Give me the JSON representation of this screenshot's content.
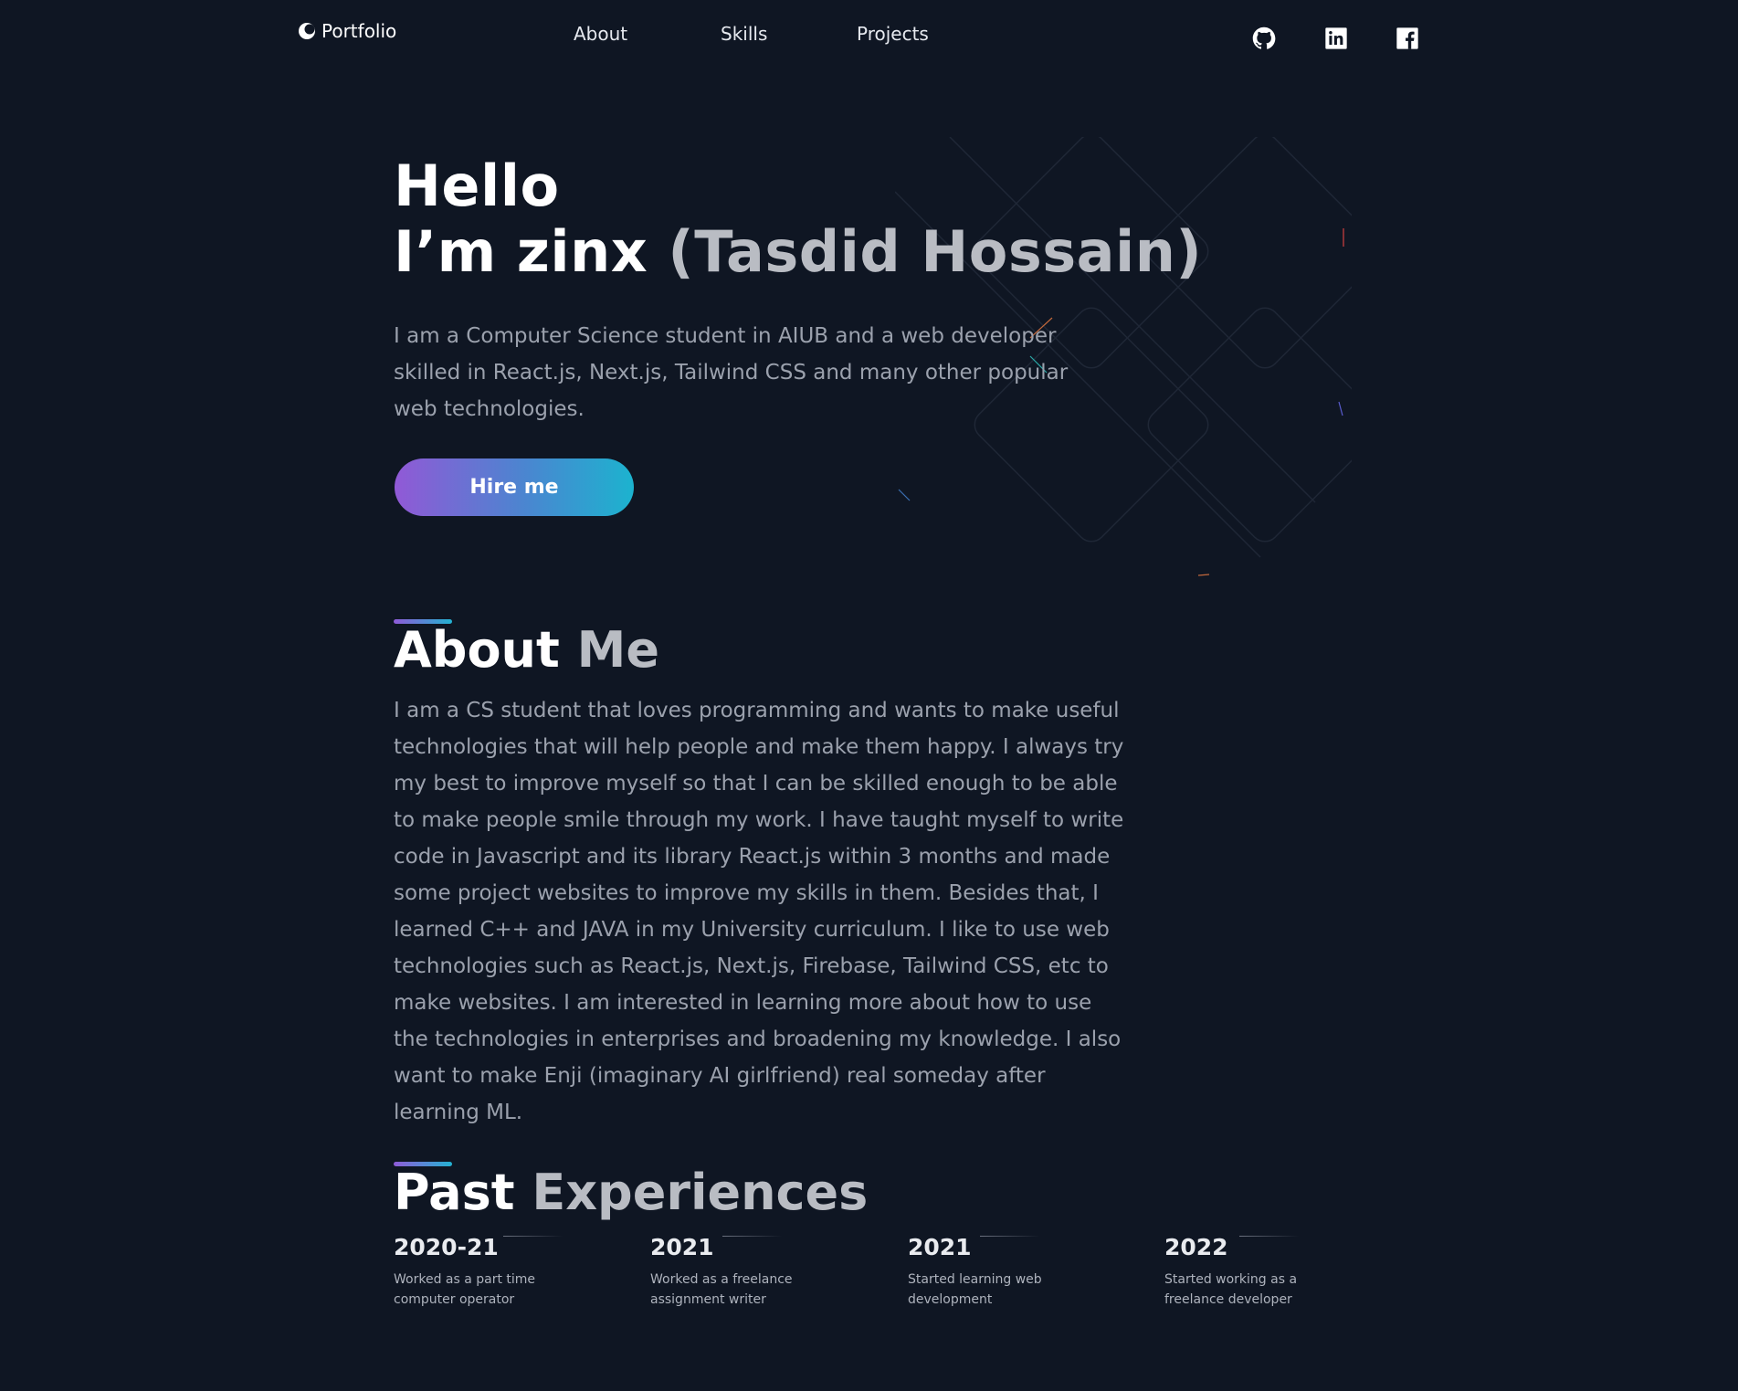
{
  "navbar": {
    "brand": "Portfolio",
    "links": [
      "About",
      "Skills",
      "Projects"
    ],
    "socials": [
      "github-icon",
      "linkedin-icon",
      "facebook-icon"
    ]
  },
  "hero": {
    "greeting": "Hello",
    "intro": "I’m zinx ",
    "real_name": "(Tasdid Hossain)",
    "description": "I am a Computer Science student in AIUB and a web developer skilled in React.js, Next.js, Tailwind CSS and many other popular web technologies.",
    "cta_label": "Hire me"
  },
  "about": {
    "title_part1": "About ",
    "title_part2": "Me",
    "text": "I am a CS student that loves programming and wants to make useful technologies that will help people and make them happy. I always try my best to improve myself so that I can be skilled enough to be able to make people smile through my work. I have taught myself to write code in Javascript and its library React.js within 3 months and made some project websites to improve my skills in them. Besides that, I learned C++ and JAVA in my University curriculum. I like to use web technologies such as React.js, Next.js, Firebase, Tailwind CSS, etc to make websites. I am interested in learning more about how to use the technologies in enterprises and broadening my knowledge. I also want to make Enji (imaginary AI girlfriend) real someday after learning ML."
  },
  "experiences": {
    "title_part1": "Past ",
    "title_part2": "Experiences",
    "items": [
      {
        "year": "2020-21",
        "desc": "Worked as a part time computer operator"
      },
      {
        "year": "2021",
        "desc": "Worked as a freelance assignment writer"
      },
      {
        "year": "2021",
        "desc": "Started learning web development"
      },
      {
        "year": "2022",
        "desc": "Started working as a freelance developer"
      }
    ]
  },
  "colors": {
    "background": "#0f1623",
    "accent_start": "#9159d6",
    "accent_end": "#1cb3cf",
    "muted_text": "#9ba1ad"
  }
}
